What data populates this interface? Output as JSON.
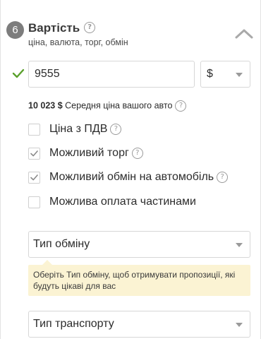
{
  "section": {
    "step": "6",
    "title": "Вартість",
    "subtitle": "ціна, валюта, торг, обмін"
  },
  "price": {
    "value": "9555",
    "currency": "$"
  },
  "average": {
    "amount": "10 023 $",
    "label": "Середня ціна вашого авто"
  },
  "options": [
    {
      "label": "Ціна з ПДВ",
      "checked": false,
      "help": true
    },
    {
      "label": "Можливий торг",
      "checked": true,
      "help": true
    },
    {
      "label": "Можливий обмін на автомобіль",
      "checked": true,
      "help": true
    },
    {
      "label": "Можлива оплата частинами",
      "checked": false,
      "help": false
    }
  ],
  "exchange_type": {
    "label": "Тип обміну",
    "hint": "Оберіть Тип обміну, щоб отримувати пропозиції, які будуть цікаві для вас"
  },
  "transport_type": {
    "label": "Тип транспорту"
  },
  "colors": {
    "accent_green": "#5aa02c",
    "hint_bg": "#fbf3d3",
    "badge": "#7d7d7d"
  }
}
